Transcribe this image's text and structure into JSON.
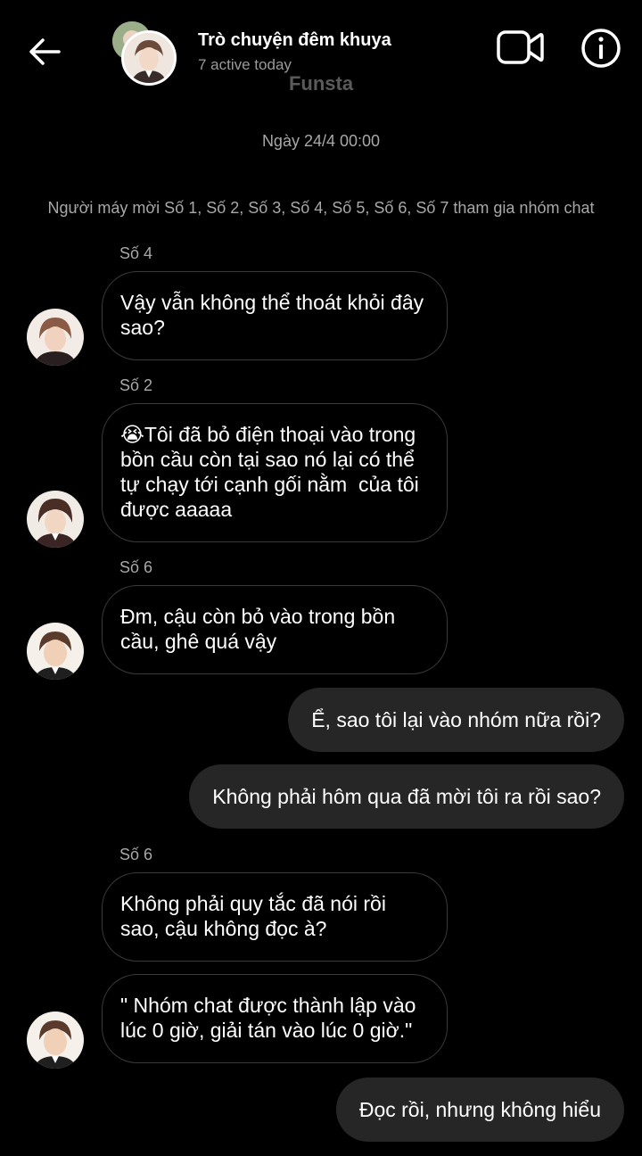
{
  "header": {
    "title": "Trò chuyện đêm khuya",
    "subtitle": "7 active today",
    "watermark": "Funsta",
    "icons": [
      "back-arrow-icon",
      "video-call-icon",
      "info-icon"
    ]
  },
  "system": {
    "date": "Ngày 24/4 00:00",
    "invite": "Người máy mời Số 1, Số 2, Số 3, Số 4, Số 5, Số 6, Số 7 tham gia nhóm chat"
  },
  "messages": [
    {
      "sender": "Số 4",
      "text": "Vậy vẫn không thể thoát khỏi đây sao?"
    },
    {
      "sender": "Số 2",
      "text": "😭Tôi đã bỏ điện thoại vào trong bồn cầu còn tại sao nó lại có thể tự chạy tới cạnh gối nằm  của tôi được aaaaa"
    },
    {
      "sender": "Số 6",
      "text": "Đm, cậu còn bỏ vào trong bồn cầu, ghê quá vậy"
    },
    {
      "sender": "",
      "text": "Ể, sao tôi lại vào nhóm nữa rồi?"
    },
    {
      "sender": "",
      "text": "Không phải hôm qua đã mời tôi ra rồi sao?"
    },
    {
      "sender": "Số 6",
      "text": "Không phải quy tắc đã nói rồi sao, cậu không đọc à?"
    },
    {
      "sender": "",
      "text": "\" Nhóm chat được thành lập vào lúc 0 giờ, giải tán vào lúc 0 giờ.\""
    },
    {
      "sender": "",
      "text": "Đọc rồi, nhưng không hiểu"
    }
  ],
  "colors": {
    "background": "#000000",
    "outgoing_bubble": "#262626",
    "incoming_border": "#3a3a3a",
    "muted_text": "#a8a8a8"
  }
}
